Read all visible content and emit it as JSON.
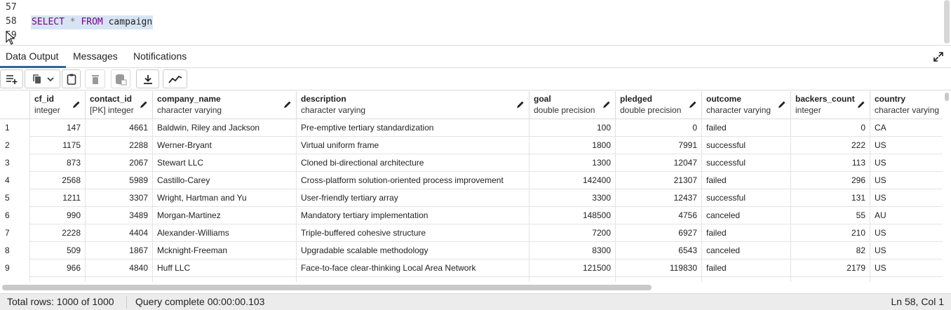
{
  "editor": {
    "line_numbers": [
      "57",
      "58",
      "59"
    ],
    "query": {
      "kw1": "SELECT",
      "op": "*",
      "kw2": "FROM",
      "table": "campaign"
    }
  },
  "tabs": [
    {
      "label": "Data Output",
      "active": true
    },
    {
      "label": "Messages",
      "active": false
    },
    {
      "label": "Notifications",
      "active": false
    }
  ],
  "toolbar": {
    "buttons": [
      "add-row-icon",
      "copy-icon",
      "chevron-down-icon",
      "paste-icon",
      "delete-icon",
      "save-data-icon",
      "download-icon",
      "graph-visualiser-icon"
    ]
  },
  "columns": [
    {
      "name": "cf_id",
      "type": "integer"
    },
    {
      "name": "contact_id",
      "type": "[PK] integer"
    },
    {
      "name": "company_name",
      "type": "character varying"
    },
    {
      "name": "description",
      "type": "character varying"
    },
    {
      "name": "goal",
      "type": "double precision"
    },
    {
      "name": "pledged",
      "type": "double precision"
    },
    {
      "name": "outcome",
      "type": "character varying"
    },
    {
      "name": "backers_count",
      "type": "integer"
    },
    {
      "name": "country",
      "type": "character varying"
    }
  ],
  "rows": [
    [
      "1",
      "147",
      "4661",
      "Baldwin, Riley and Jackson",
      "Pre-emptive tertiary standardization",
      "100",
      "0",
      "failed",
      "0",
      "CA"
    ],
    [
      "2",
      "1175",
      "2288",
      "Werner-Bryant",
      "Virtual uniform frame",
      "1800",
      "7991",
      "successful",
      "222",
      "US"
    ],
    [
      "3",
      "873",
      "2067",
      "Stewart LLC",
      "Cloned bi-directional architecture",
      "1300",
      "12047",
      "successful",
      "113",
      "US"
    ],
    [
      "4",
      "2568",
      "5989",
      "Castillo-Carey",
      "Cross-platform solution-oriented process improvement",
      "142400",
      "21307",
      "failed",
      "296",
      "US"
    ],
    [
      "5",
      "1211",
      "3307",
      "Wright, Hartman and Yu",
      "User-friendly tertiary array",
      "3300",
      "12437",
      "successful",
      "131",
      "US"
    ],
    [
      "6",
      "990",
      "3489",
      "Morgan-Martinez",
      "Mandatory tertiary implementation",
      "148500",
      "4756",
      "canceled",
      "55",
      "AU"
    ],
    [
      "7",
      "2228",
      "4404",
      "Alexander-Williams",
      "Triple-buffered cohesive structure",
      "7200",
      "6927",
      "failed",
      "210",
      "US"
    ],
    [
      "8",
      "509",
      "1867",
      "Mcknight-Freeman",
      "Upgradable scalable methodology",
      "8300",
      "6543",
      "canceled",
      "82",
      "US"
    ],
    [
      "9",
      "966",
      "4840",
      "Huff LLC",
      "Face-to-face clear-thinking Local Area Network",
      "121500",
      "119830",
      "failed",
      "2179",
      "US"
    ]
  ],
  "status": {
    "total_rows": "Total rows: 1000 of 1000",
    "query_time": "Query complete 00:00:00.103",
    "position": "Ln 58, Col 1"
  },
  "colors": {
    "accent": "#326690",
    "keyword": "#770088",
    "selection": "#d7e4f3"
  }
}
